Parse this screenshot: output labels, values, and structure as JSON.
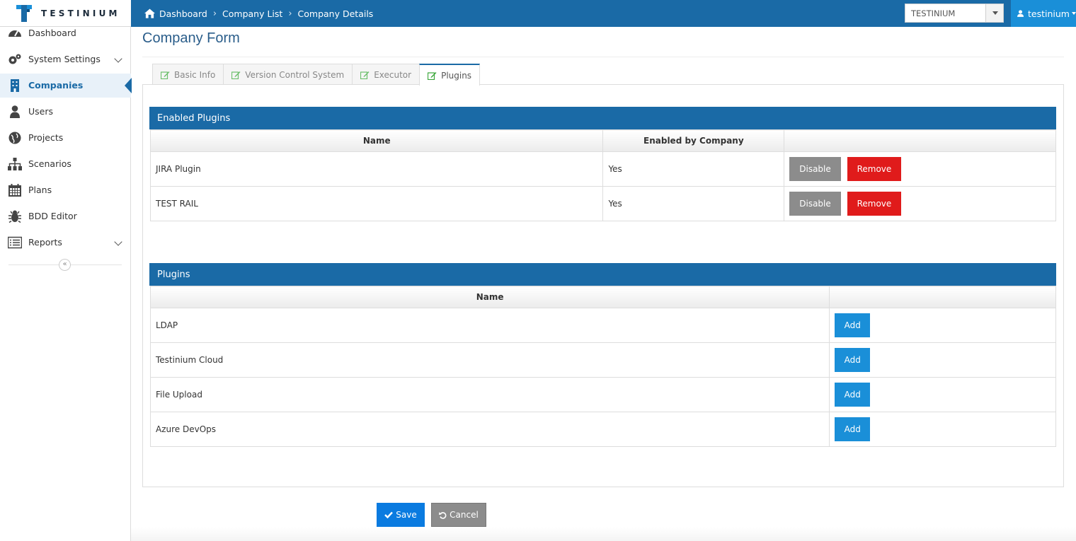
{
  "header": {
    "logo_text": "TESTINIUM",
    "breadcrumb": [
      "Dashboard",
      "Company List",
      "Company Details"
    ],
    "company_select": "TESTINIUM",
    "user": "testinium"
  },
  "sidebar": {
    "items": [
      {
        "label": "Dashboard",
        "icon": "dashboard-icon"
      },
      {
        "label": "System Settings",
        "icon": "gears-icon"
      },
      {
        "label": "Companies",
        "icon": "building-icon"
      },
      {
        "label": "Users",
        "icon": "user-icon"
      },
      {
        "label": "Projects",
        "icon": "globe-icon"
      },
      {
        "label": "Scenarios",
        "icon": "sitemap-icon"
      },
      {
        "label": "Plans",
        "icon": "calendar-icon"
      },
      {
        "label": "BDD Editor",
        "icon": "bug-icon"
      },
      {
        "label": "Reports",
        "icon": "list-icon"
      }
    ],
    "collapse": "«"
  },
  "main": {
    "title": "Company Form",
    "tabs": [
      "Basic Info",
      "Version Control System",
      "Executor",
      "Plugins"
    ],
    "enabled": {
      "title": "Enabled Plugins",
      "headers": [
        "Name",
        "Enabled by Company",
        ""
      ],
      "rows": [
        {
          "name": "JIRA Plugin",
          "enabled": "Yes",
          "disable": "Disable",
          "remove": "Remove"
        },
        {
          "name": "TEST RAIL",
          "enabled": "Yes",
          "disable": "Disable",
          "remove": "Remove"
        }
      ]
    },
    "plugins": {
      "title": "Plugins",
      "headers": [
        "Name",
        ""
      ],
      "rows": [
        {
          "name": "LDAP",
          "add": "Add"
        },
        {
          "name": "Testinium Cloud",
          "add": "Add"
        },
        {
          "name": "File Upload",
          "add": "Add"
        },
        {
          "name": "Azure DevOps",
          "add": "Add"
        }
      ]
    },
    "save": "Save",
    "cancel": "Cancel"
  },
  "colors": {
    "brand": "#1a6aa6",
    "accent": "#1a8fd8",
    "danger": "#e01b1b",
    "neutral": "#8c8c8c"
  }
}
